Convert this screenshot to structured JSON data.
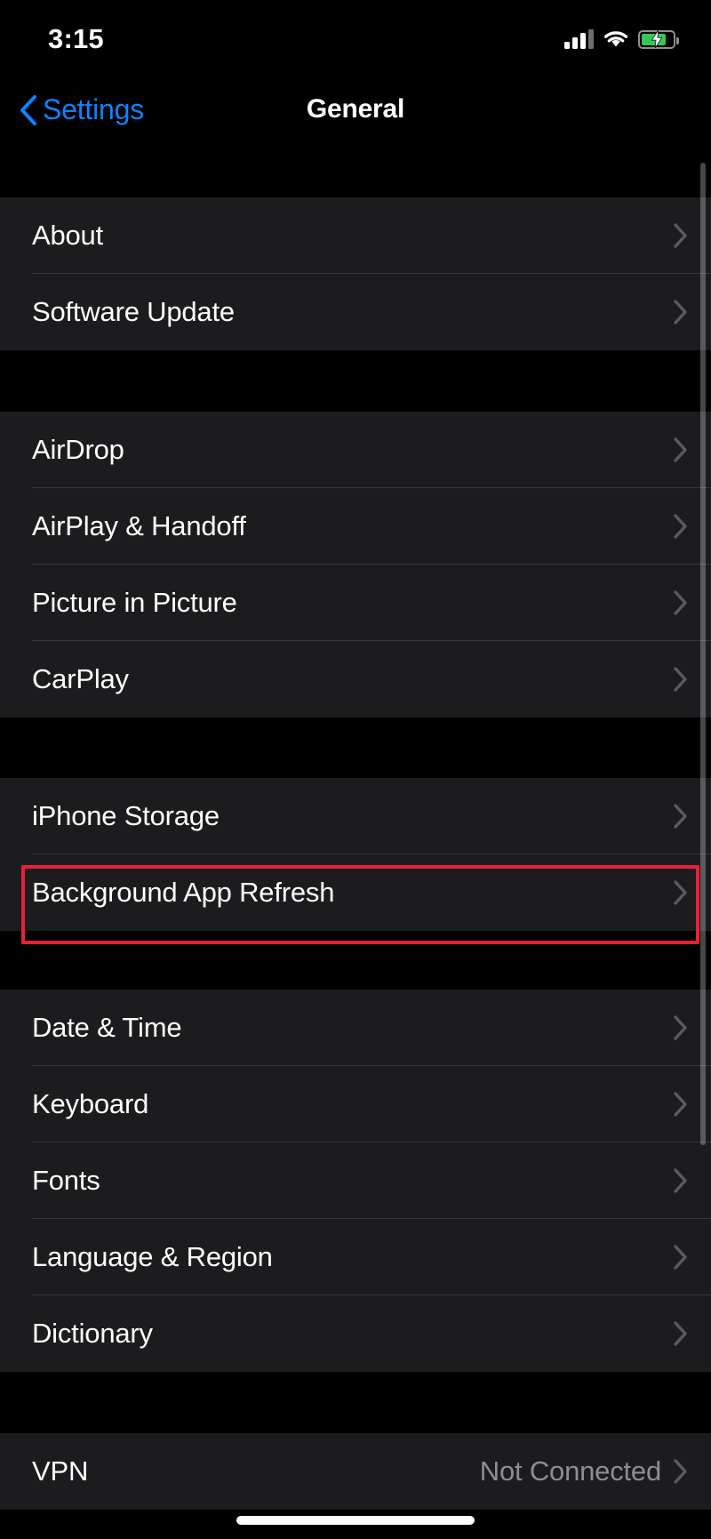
{
  "status_bar": {
    "time": "3:15",
    "cellular_icon": "cellular-signal-icon",
    "cellular_bars_active": 3,
    "cellular_bars_total": 4,
    "wifi_icon": "wifi-icon",
    "battery_icon": "battery-charging-icon",
    "battery_level_percent": 78,
    "battery_color": "#34c759",
    "charging": true
  },
  "nav_bar": {
    "back_icon": "chevron-left-icon",
    "back_label": "Settings",
    "title": "General",
    "accent_color": "#0a84ff"
  },
  "sections": [
    {
      "id": "about-section",
      "rows": [
        {
          "label": "About",
          "value": "",
          "accessory": "chevron-right-icon"
        },
        {
          "label": "Software Update",
          "value": "",
          "accessory": "chevron-right-icon"
        }
      ]
    },
    {
      "id": "connectivity-section",
      "rows": [
        {
          "label": "AirDrop",
          "value": "",
          "accessory": "chevron-right-icon"
        },
        {
          "label": "AirPlay & Handoff",
          "value": "",
          "accessory": "chevron-right-icon"
        },
        {
          "label": "Picture in Picture",
          "value": "",
          "accessory": "chevron-right-icon"
        },
        {
          "label": "CarPlay",
          "value": "",
          "accessory": "chevron-right-icon"
        }
      ]
    },
    {
      "id": "storage-section",
      "rows": [
        {
          "label": "iPhone Storage",
          "value": "",
          "accessory": "chevron-right-icon"
        },
        {
          "label": "Background App Refresh",
          "value": "",
          "accessory": "chevron-right-icon"
        }
      ]
    },
    {
      "id": "localization-section",
      "rows": [
        {
          "label": "Date & Time",
          "value": "",
          "accessory": "chevron-right-icon"
        },
        {
          "label": "Keyboard",
          "value": "",
          "accessory": "chevron-right-icon"
        },
        {
          "label": "Fonts",
          "value": "",
          "accessory": "chevron-right-icon"
        },
        {
          "label": "Language & Region",
          "value": "",
          "accessory": "chevron-right-icon"
        },
        {
          "label": "Dictionary",
          "value": "",
          "accessory": "chevron-right-icon"
        }
      ]
    },
    {
      "id": "vpn-section",
      "rows": [
        {
          "label": "VPN",
          "value": "Not Connected",
          "accessory": "chevron-right-icon"
        }
      ]
    }
  ],
  "highlight": {
    "target_label": "Background App Refresh",
    "color": "#e8203a"
  },
  "home_indicator": "home-indicator-bar"
}
